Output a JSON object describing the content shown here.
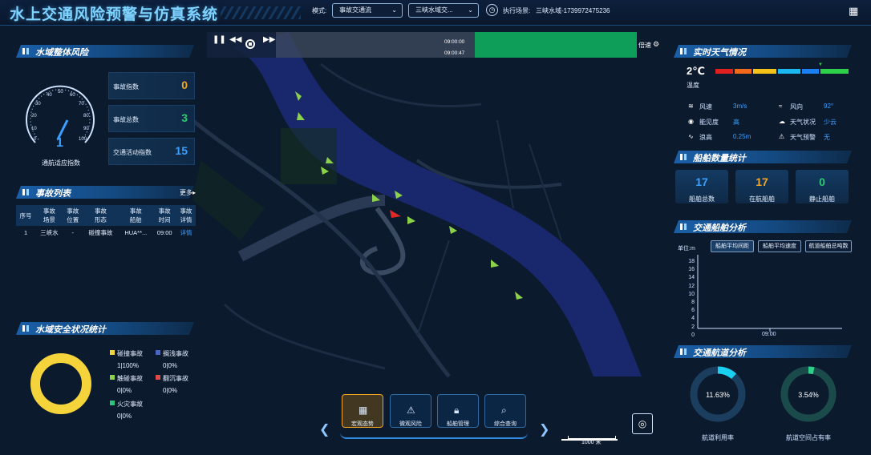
{
  "header": {
    "title": "水上交通风险预警与仿真系统",
    "mode_label": "模式:",
    "mode_value": "事故交通流",
    "scene_value": "三峡水域交...",
    "exec_label": "执行场景:",
    "exec_value": "三峡水域-1739972475236"
  },
  "timeline": {
    "time_top": "09:00:00",
    "time_bottom": "09:00:47",
    "speed_label": "倍速",
    "progress": 0.55
  },
  "overall": {
    "title": "水域整体风险",
    "gauge_value": "1",
    "gauge_label": "通航适应指数",
    "gauge_ticks": [
      "0",
      "10",
      "20",
      "30",
      "40",
      "50",
      "60",
      "70",
      "80",
      "90",
      "100"
    ],
    "stats": [
      {
        "label": "事故指数",
        "value": "0",
        "color": "#f5a623"
      },
      {
        "label": "事故总数",
        "value": "3",
        "color": "#2ecc71"
      },
      {
        "label": "交通活动指数",
        "value": "15",
        "color": "#3aa0ff"
      }
    ]
  },
  "accidents": {
    "title": "事故列表",
    "more": "更多",
    "headers": [
      [
        "序号"
      ],
      [
        "事故",
        "场景"
      ],
      [
        "事故",
        "位置"
      ],
      [
        "事故",
        "形态"
      ],
      [
        "事故",
        "船舶"
      ],
      [
        "事故",
        "时间"
      ],
      [
        "事故",
        "详情"
      ]
    ],
    "rows": [
      [
        "1",
        "三峡水",
        "-",
        "碰撞事故",
        "HUA**...",
        "09:00",
        "详情"
      ]
    ]
  },
  "safety": {
    "title": "水域安全状况统计",
    "legend": [
      {
        "name": "碰撞事故",
        "value": "1|100%",
        "color": "#f5d33a"
      },
      {
        "name": "搁浅事故",
        "value": "0|0%",
        "color": "#4a64c8"
      },
      {
        "name": "触碰事故",
        "value": "0|0%",
        "color": "#8bd14a"
      },
      {
        "name": "翻沉事故",
        "value": "0|0%",
        "color": "#e04a4a"
      },
      {
        "name": "火灾事故",
        "value": "0|0%",
        "color": "#2ec27a"
      }
    ]
  },
  "weather": {
    "title": "实时天气情况",
    "temp": "2℃",
    "temp_label": "温度",
    "items": [
      {
        "icon": "wind-icon",
        "label": "风速",
        "value": "3m/s"
      },
      {
        "icon": "wind-direction-icon",
        "label": "风向",
        "value": "92°"
      },
      {
        "icon": "eye-icon",
        "label": "能见度",
        "value": "高"
      },
      {
        "icon": "cloud-icon",
        "label": "天气状况",
        "value": "少云"
      },
      {
        "icon": "wave-icon",
        "label": "浪高",
        "value": "0.25m"
      },
      {
        "icon": "warning-icon",
        "label": "天气预警",
        "value": "无"
      }
    ],
    "scale_colors": [
      "#e02020",
      "#f06a1a",
      "#f5c21a",
      "#1ab8f0",
      "#1a7ff0",
      "#2ed04a"
    ]
  },
  "ships": {
    "title": "船舶数量统计",
    "items": [
      {
        "label": "船舶总数",
        "value": "17",
        "color": "#3aa0ff"
      },
      {
        "label": "在航船舶",
        "value": "17",
        "color": "#f5a623"
      },
      {
        "label": "静止船舶",
        "value": "0",
        "color": "#2ecc71"
      }
    ]
  },
  "traffic": {
    "title": "交通船舶分析",
    "unit": "单位:m",
    "tabs": [
      "船舶平均间距",
      "船舶平均速度",
      "航道船舶总吨数"
    ],
    "yticks": [
      "18",
      "16",
      "14",
      "12",
      "10",
      "8",
      "6",
      "4",
      "2",
      "0"
    ],
    "xtick": "09:00"
  },
  "channel": {
    "title": "交通航道分析",
    "donuts": [
      {
        "value": "11.63%",
        "label": "航道利用率",
        "pct": 0.1163,
        "color": "#1ad0f0"
      },
      {
        "value": "3.54%",
        "label": "航道空间占有率",
        "pct": 0.0354,
        "color": "#2ed08a"
      }
    ]
  },
  "bottom_nav": [
    {
      "label": "宏观态势",
      "icon": "chart-icon"
    },
    {
      "label": "微观风险",
      "icon": "warning-icon"
    },
    {
      "label": "船舶管理",
      "icon": "lock-icon"
    },
    {
      "label": "综合查询",
      "icon": "search-icon"
    }
  ],
  "scale_bar": "1000 米",
  "chart_data": {
    "type": "line",
    "categories": [
      "09:00"
    ],
    "ylim": [
      0,
      18
    ],
    "ylabel": "单位:m",
    "series": []
  }
}
